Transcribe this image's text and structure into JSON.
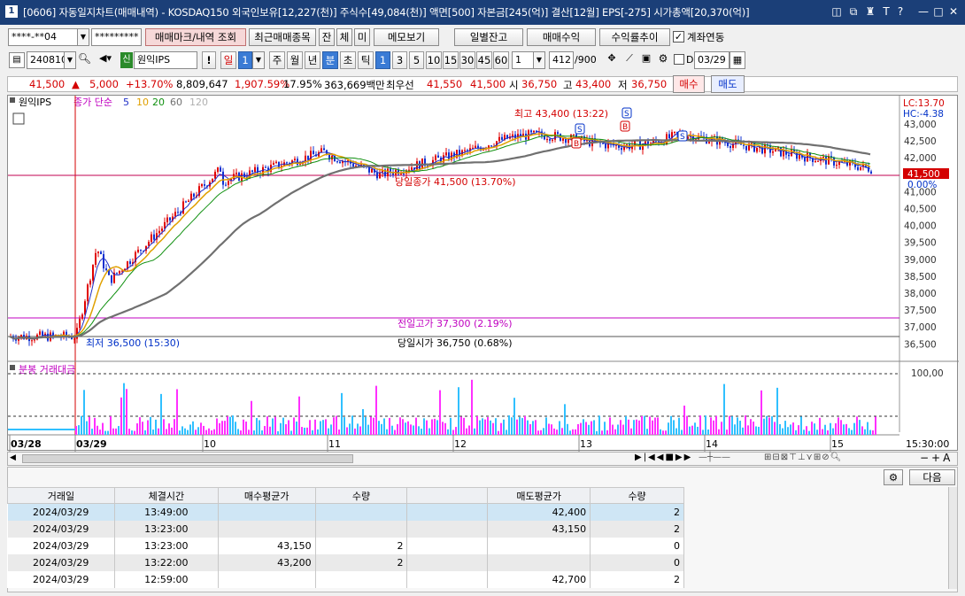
{
  "titlebar": {
    "app_number": "1",
    "title": "[0606] 자동일지차트(매매내역) - KOSDAQ150 외국인보유[12,227(천)] 주식수[49,084(천)] 액면[500] 자본금[245(억)] 결산[12월] EPS[-275] 시가총액[20,370(억)]"
  },
  "toolbar1": {
    "account": "****-**04",
    "password": "*********",
    "trade_mark_button": "매매마크/내역 조회",
    "recent_trades_button": "최근매매종목",
    "tab_jan": "잔",
    "tab_che": "체",
    "tab_mi": "미",
    "memo_button": "메모보기",
    "daily_balance_button": "일별잔고",
    "trade_profit_button": "매매수익",
    "return_trend_button": "수익률추이",
    "account_link_label": "계좌연동",
    "account_link_checked": true
  },
  "toolbar2": {
    "code": "240810",
    "stock_badge": "신",
    "stock_name": "원익IPS",
    "exclaim": "!",
    "period_day": "일",
    "period_num": "1",
    "period_week": "주",
    "period_month": "월",
    "period_year": "년",
    "period_min": "분",
    "period_sec": "초",
    "period_tick": "틱",
    "intervals": [
      "1",
      "3",
      "5",
      "10",
      "15",
      "30",
      "45",
      "60"
    ],
    "interval_value": "1",
    "count_value": "412",
    "count_total": "/900",
    "d_label": "D",
    "date_value": "03/29"
  },
  "pricebar": {
    "price": "41,500",
    "arrow": "▲",
    "change": "5,000",
    "change_pct": "+13.70%",
    "volume": "8,809,647",
    "volume_ratio": "1,907.59%",
    "turnover_pct": "17.95%",
    "amount": "363,669백만",
    "best_bid_label": "최우선",
    "best_ask": "41,550",
    "best_bid": "41,500",
    "open_label": "시",
    "open": "36,750",
    "high_label": "고",
    "high": "43,400",
    "low_label": "저",
    "low": "36,750",
    "buy_button": "매수",
    "sell_button": "매도"
  },
  "chart": {
    "stock_label": "원익IPS",
    "ma_label": "종가 단순",
    "ma_periods": [
      "5",
      "10",
      "20",
      "60",
      "120"
    ],
    "ma_colors": [
      "#2030c8",
      "#e0a000",
      "#109010",
      "#707070",
      "#b0b0b0"
    ],
    "lc_label": "LC:13.70",
    "hc_label": "HC:-4.38",
    "high_annot": "최고 43,400 (13:22)",
    "low_annot": "최저 36,500 (15:30)",
    "close_annot": "당일종가 41,500 (13.70%)",
    "prev_high_annot": "전일고가 37,300 (2.19%)",
    "open_annot": "당일시가 36,750 (0.68%)",
    "price_tag": "41,500",
    "pct_tag": "0.00%",
    "y_ticks": [
      "43,000",
      "42,500",
      "42,000",
      "41,500",
      "41,000",
      "40,500",
      "40,000",
      "39,500",
      "39,000",
      "38,500",
      "38,000",
      "37,500",
      "37,000",
      "36,500"
    ],
    "vol_label": "분봉 거래대금",
    "vol_tick": "100,00",
    "x_labels": [
      "03/28",
      "03/29",
      "10",
      "11",
      "12",
      "13",
      "14",
      "15"
    ],
    "x_time": "15:30:00",
    "colors": {
      "up": "#e00000",
      "down": "#1030d0",
      "ref_line": "#c000c0",
      "vol_up": "#ff30ff",
      "vol_down": "#30c0ff"
    }
  },
  "grid": {
    "settings_button": "⚙",
    "next_button": "다음",
    "columns": [
      "거래일",
      "체결시간",
      "매수평균가",
      "수량",
      "",
      "매도평균가",
      "수량"
    ],
    "rows": [
      [
        "2024/03/29",
        "13:49:00",
        "",
        "",
        "",
        "42,400",
        "2"
      ],
      [
        "2024/03/29",
        "13:23:00",
        "",
        "",
        "",
        "43,150",
        "2"
      ],
      [
        "2024/03/29",
        "13:23:00",
        "43,150",
        "2",
        "",
        "",
        "0"
      ],
      [
        "2024/03/29",
        "13:22:00",
        "43,200",
        "2",
        "",
        "",
        "0"
      ],
      [
        "2024/03/29",
        "12:59:00",
        "",
        "",
        "",
        "42,700",
        "2"
      ]
    ]
  }
}
